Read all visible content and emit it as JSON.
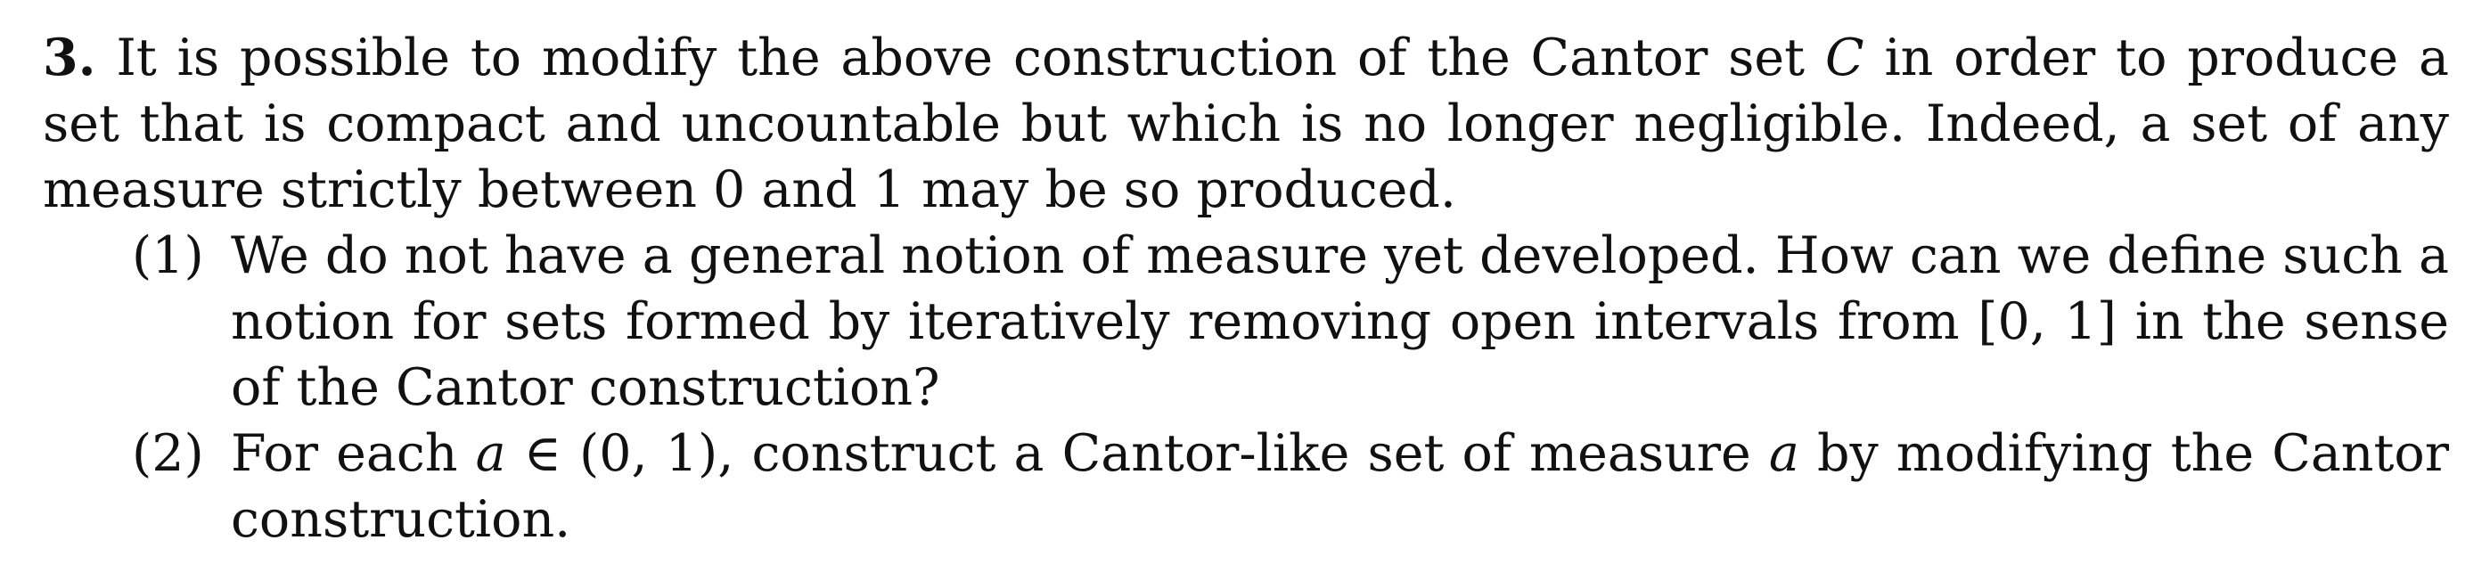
{
  "problem": {
    "number": "3.",
    "intro_before_symbol": "It is possible to modify the above construction of the Cantor set",
    "set_symbol": "C",
    "intro_after_symbol": "in order to produce a set that is compact and uncountable but which is no longer negligible. Indeed, a set of any measure strictly between 0 and 1 may be so produced.",
    "parts": [
      {
        "label": "(1)",
        "text": "We do not have a general notion of measure yet developed. How can we define such a notion for sets formed by iteratively removing open intervals from [0, 1] in the sense of the Cantor construction?"
      },
      {
        "label": "(2)",
        "text_before_a1": "For each",
        "var_a1": "a",
        "text_between": "∈ (0, 1), construct a Cantor-like set of measure",
        "var_a2": "a",
        "text_after_a2": "by modifying the Cantor construction."
      }
    ]
  }
}
